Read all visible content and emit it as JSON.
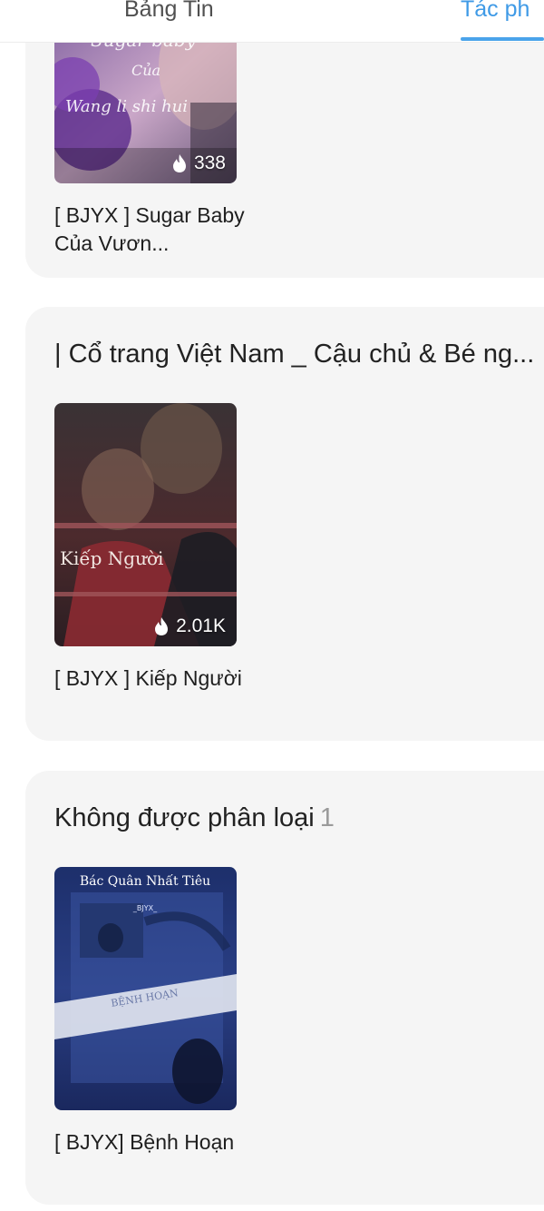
{
  "tabs": {
    "news_label": "Bảng Tin",
    "works_label": "Tác ph"
  },
  "colors": {
    "accent": "#4aa3ea",
    "panel_bg": "#f5f5f5"
  },
  "sections": [
    {
      "title": "",
      "books": [
        {
          "title": "[ BJYX ] Sugar Baby Của Vươn...",
          "views": "338",
          "cover_text": [
            "Sugar baby",
            "Của",
            "Wang li shi hui"
          ]
        }
      ]
    },
    {
      "title": "| Cổ trang Việt Nam _ Cậu chủ & Bé ng...",
      "books": [
        {
          "title": "[ BJYX ] Kiếp Người",
          "views": "2.01K",
          "cover_text": [
            "Kiếp Người"
          ]
        }
      ]
    },
    {
      "title": "Không được phân loại",
      "count": "1",
      "books": [
        {
          "title": "[ BJYX] Bệnh Hoạn",
          "cover_text": [
            "Bác Quân Nhất Tiêu",
            "_BJYX_",
            "BỆNH HOẠN"
          ]
        }
      ]
    }
  ],
  "icons": {
    "views": "flame-icon"
  }
}
